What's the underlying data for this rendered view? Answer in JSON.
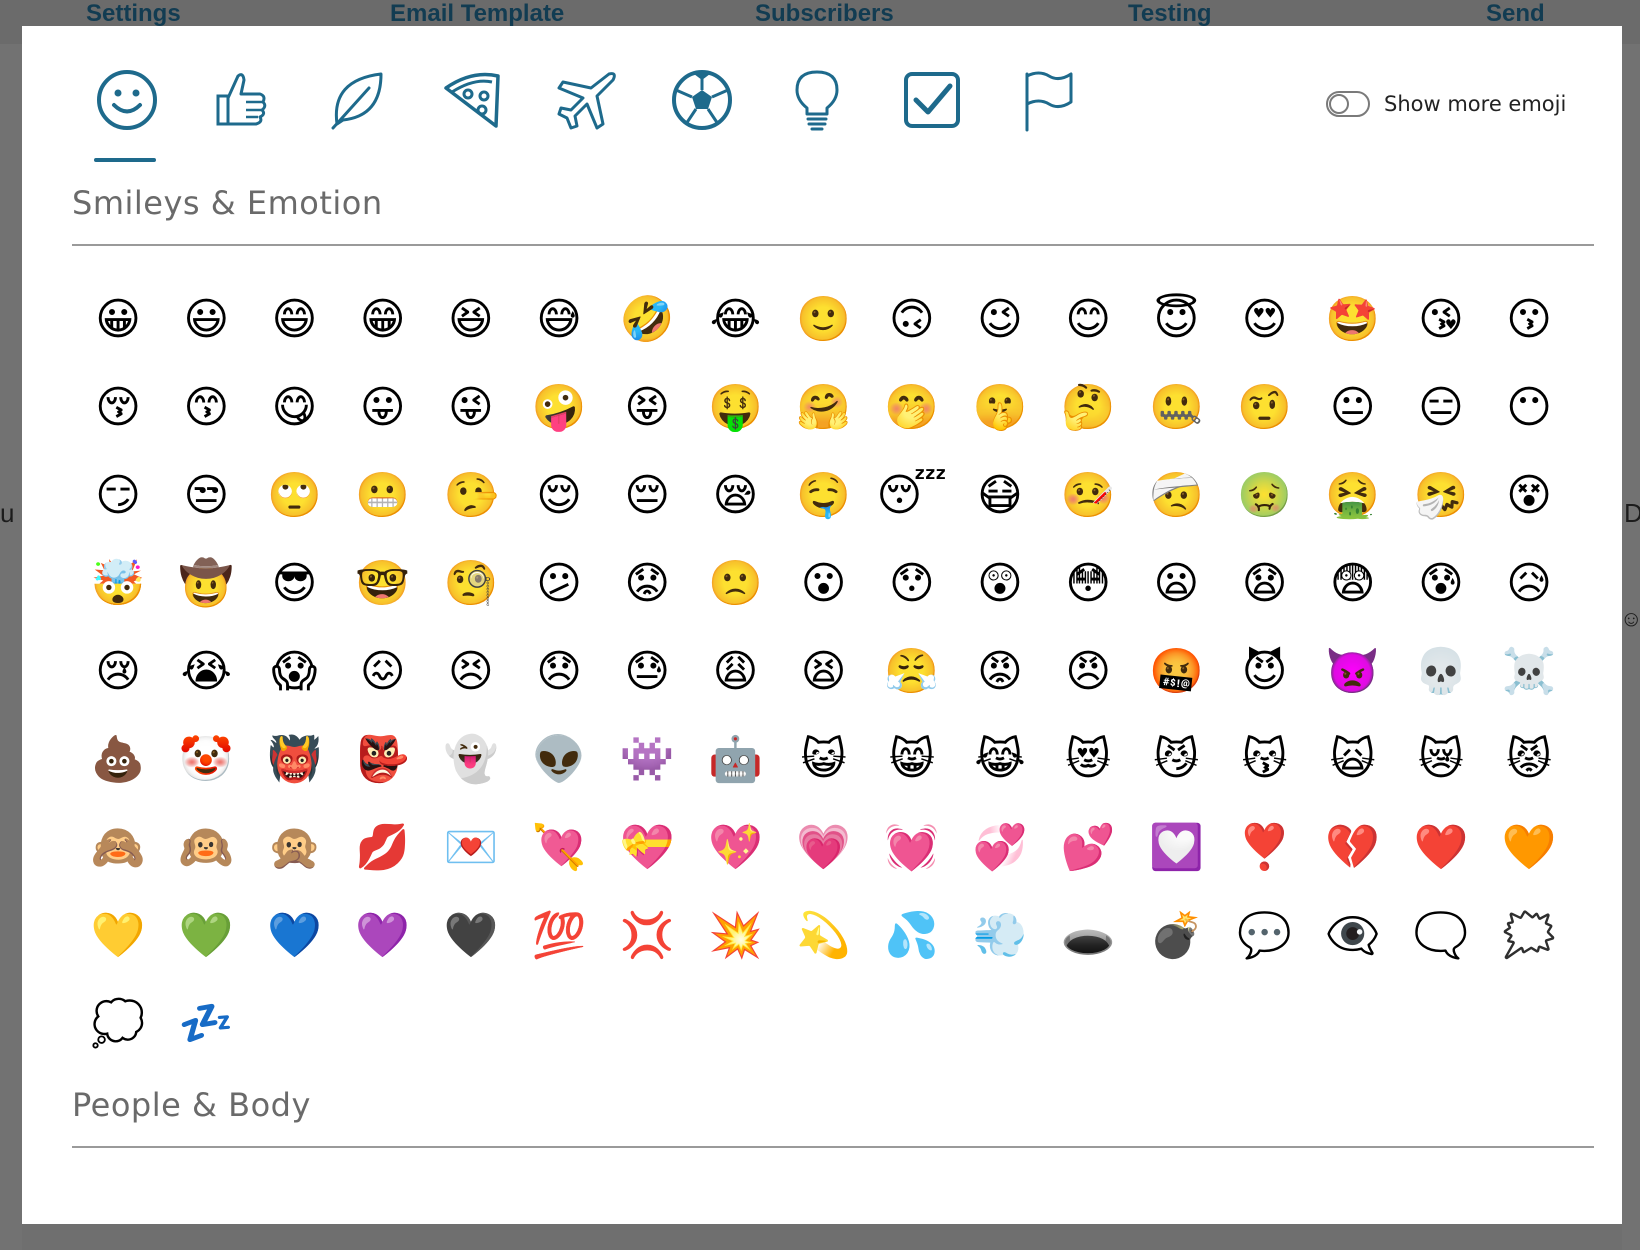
{
  "steps": [
    "Settings",
    "Email Template",
    "Subscribers",
    "Testing",
    "Send"
  ],
  "background_fragments": {
    "left": "u",
    "right": "D",
    "right_icon": "☺"
  },
  "categories": [
    {
      "name": "smileys",
      "icon": "smiley-face-icon",
      "active": true
    },
    {
      "name": "people",
      "icon": "thumbs-up-icon",
      "active": false
    },
    {
      "name": "nature",
      "icon": "leaf-icon",
      "active": false
    },
    {
      "name": "food",
      "icon": "pizza-slice-icon",
      "active": false
    },
    {
      "name": "travel",
      "icon": "airplane-icon",
      "active": false
    },
    {
      "name": "activities",
      "icon": "soccer-ball-icon",
      "active": false
    },
    {
      "name": "objects",
      "icon": "lightbulb-icon",
      "active": false
    },
    {
      "name": "symbols",
      "icon": "checkbox-icon",
      "active": false
    },
    {
      "name": "flags",
      "icon": "flag-icon",
      "active": false
    }
  ],
  "toggle": {
    "label": "Show more emoji",
    "on": false
  },
  "sections": [
    {
      "title": "Smileys & Emotion",
      "emojis": [
        "😀",
        "😃",
        "😄",
        "😁",
        "😆",
        "😅",
        "🤣",
        "😂",
        "🙂",
        "🙃",
        "😉",
        "😊",
        "😇",
        "😍",
        "🤩",
        "😘",
        "😗",
        "😚",
        "😙",
        "😋",
        "😛",
        "😜",
        "🤪",
        "😝",
        "🤑",
        "🤗",
        "🤭",
        "🤫",
        "🤔",
        "🤐",
        "🤨",
        "😐",
        "😑",
        "😶",
        "😏",
        "😒",
        "🙄",
        "😬",
        "🤥",
        "😌",
        "😔",
        "😪",
        "🤤",
        "😴",
        "😷",
        "🤒",
        "🤕",
        "🤢",
        "🤮",
        "🤧",
        "😵",
        "🤯",
        "🤠",
        "😎",
        "🤓",
        "🧐",
        "😕",
        "😟",
        "🙁",
        "😮",
        "😯",
        "😲",
        "😳",
        "😦",
        "😧",
        "😨",
        "😰",
        "😥",
        "😢",
        "😭",
        "😱",
        "😖",
        "😣",
        "😞",
        "😓",
        "😩",
        "😫",
        "😤",
        "😡",
        "😠",
        "🤬",
        "😈",
        "👿",
        "💀",
        "☠️",
        "💩",
        "🤡",
        "👹",
        "👺",
        "👻",
        "👽",
        "👾",
        "🤖",
        "😺",
        "😸",
        "😹",
        "😻",
        "😼",
        "😽",
        "🙀",
        "😿",
        "😾",
        "🙈",
        "🙉",
        "🙊",
        "💋",
        "💌",
        "💘",
        "💝",
        "💖",
        "💗",
        "💓",
        "💞",
        "💕",
        "💟",
        "❣️",
        "💔",
        "❤️",
        "🧡",
        "💛",
        "💚",
        "💙",
        "💜",
        "🖤",
        "💯",
        "💢",
        "💥",
        "💫",
        "💦",
        "💨",
        "🕳️",
        "💣",
        "💬",
        "👁️‍🗨️",
        "🗨️",
        "🗯️",
        "💭",
        "💤"
      ]
    },
    {
      "title": "People & Body",
      "emojis": []
    }
  ]
}
